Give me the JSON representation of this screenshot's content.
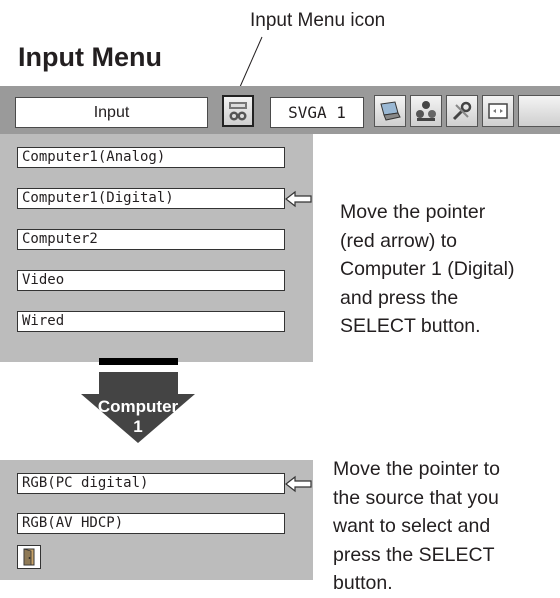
{
  "callout": {
    "text": "Input Menu icon"
  },
  "title": "Input Menu",
  "menu_bar": {
    "input_label": "Input",
    "svga_label": "SVGA 1",
    "icons": [
      "input-menu-icon",
      "laptop-icon",
      "people-icon",
      "wrench-icon",
      "screen-icon"
    ]
  },
  "input_list": [
    {
      "label": "Computer1(Analog)"
    },
    {
      "label": "Computer1(Digital)",
      "pointer": true
    },
    {
      "label": "Computer2"
    },
    {
      "label": "Video"
    },
    {
      "label": "Wired"
    }
  ],
  "instruction1": [
    "Move the pointer",
    "(red arrow) to",
    "Computer 1 (Digital)",
    "and press the",
    "SELECT button."
  ],
  "big_arrow": {
    "line1": "Computer",
    "line2": "1"
  },
  "source_list": [
    {
      "label": "RGB(PC digital)",
      "pointer": true
    },
    {
      "label": "RGB(AV HDCP)"
    }
  ],
  "exit_icon": "exit-door-icon",
  "instruction2": [
    "Move the pointer to",
    "the source that you",
    "want to select and",
    "press the SELECT",
    "button."
  ],
  "colors": {
    "menu_bar": "#9a9a9a",
    "panel": "#bcbcbc",
    "arrow": "#444444"
  }
}
